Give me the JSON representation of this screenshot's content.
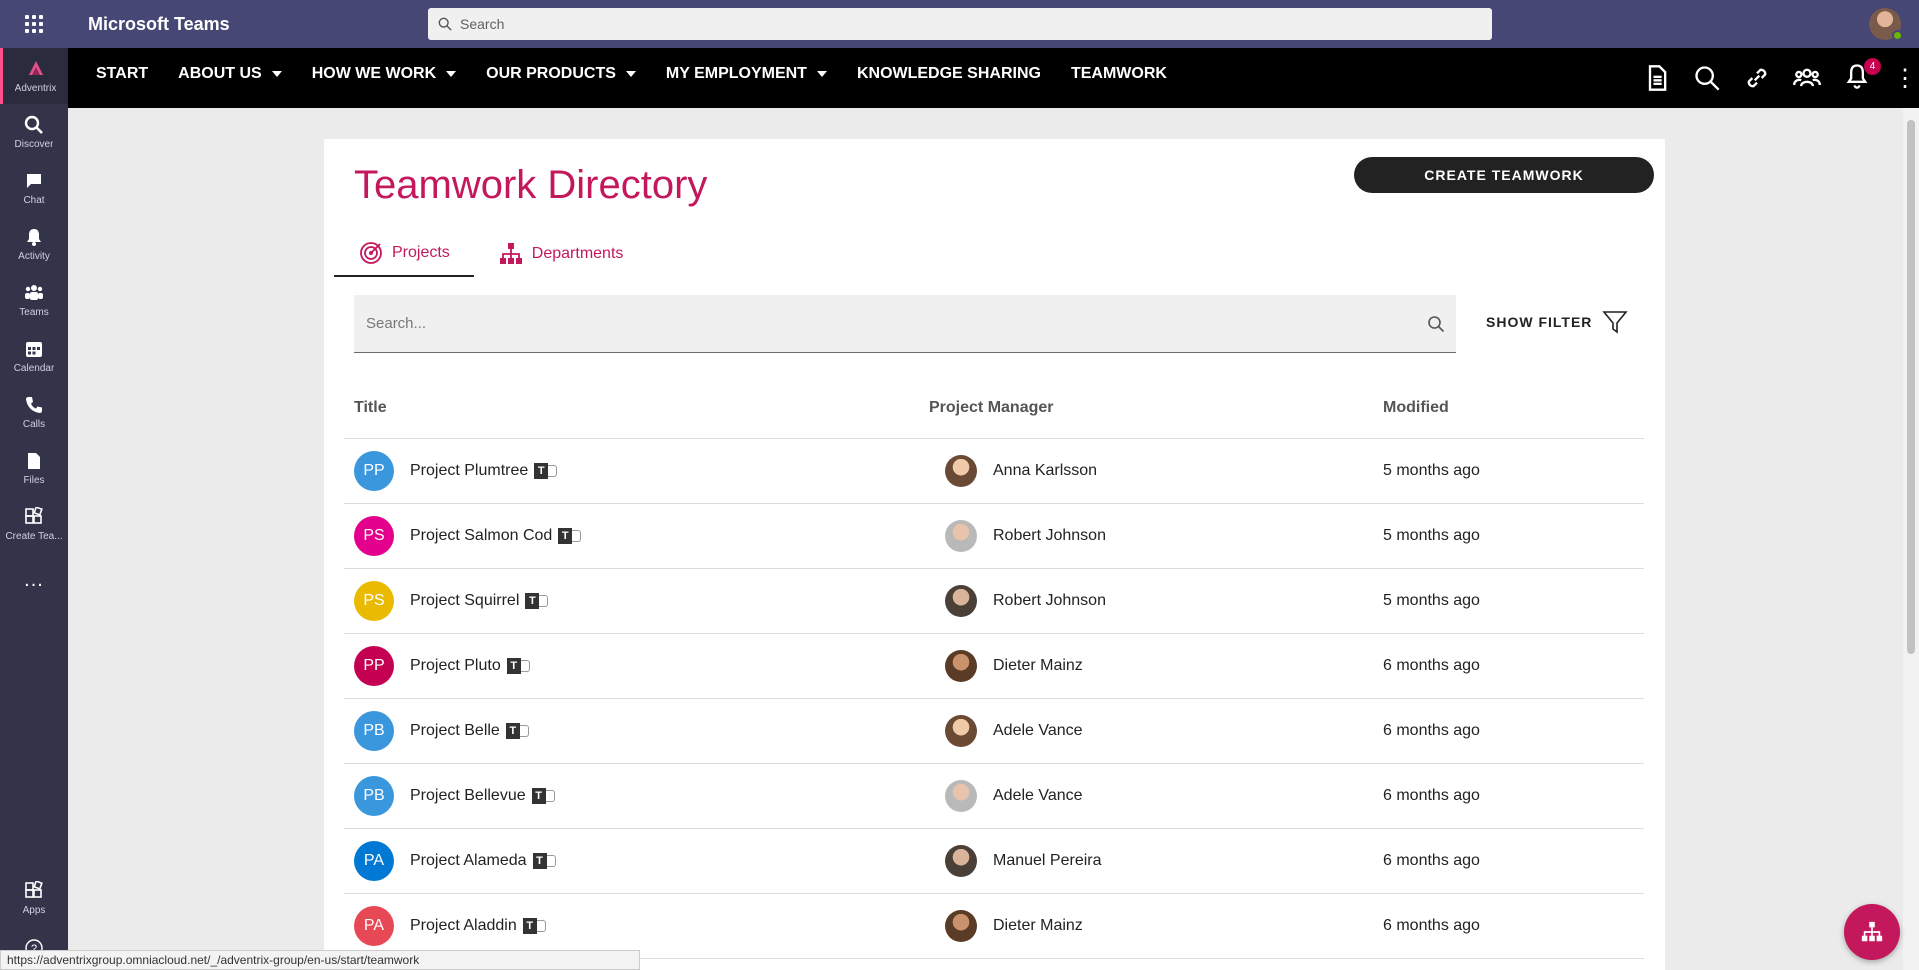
{
  "app": {
    "title": "Microsoft Teams",
    "search_placeholder": "Search"
  },
  "rail": {
    "items": [
      {
        "label": "Adventrix",
        "icon": "adventrix-logo-icon"
      },
      {
        "label": "Discover",
        "icon": "search-icon"
      },
      {
        "label": "Chat",
        "icon": "chat-icon"
      },
      {
        "label": "Activity",
        "icon": "bell-icon"
      },
      {
        "label": "Teams",
        "icon": "teams-icon"
      },
      {
        "label": "Calendar",
        "icon": "calendar-icon"
      },
      {
        "label": "Calls",
        "icon": "phone-icon"
      },
      {
        "label": "Files",
        "icon": "file-icon"
      },
      {
        "label": "Create Tea...",
        "icon": "create-team-icon"
      }
    ],
    "more": "...",
    "bottom": [
      {
        "label": "Apps",
        "icon": "apps-icon"
      },
      {
        "label": "",
        "icon": "help-icon"
      }
    ]
  },
  "nav": {
    "items": [
      {
        "label": "START",
        "dropdown": false
      },
      {
        "label": "ABOUT US",
        "dropdown": true
      },
      {
        "label": "HOW WE WORK",
        "dropdown": true
      },
      {
        "label": "OUR PRODUCTS",
        "dropdown": true
      },
      {
        "label": "MY EMPLOYMENT",
        "dropdown": true
      },
      {
        "label": "KNOWLEDGE SHARING",
        "dropdown": false
      },
      {
        "label": "TEAMWORK",
        "dropdown": false
      }
    ],
    "notification_count": "4"
  },
  "page": {
    "title": "Teamwork Directory",
    "create_button": "CREATE TEAMWORK",
    "tabs": [
      {
        "label": "Projects",
        "active": true
      },
      {
        "label": "Departments",
        "active": false
      }
    ],
    "search_placeholder": "Search...",
    "filter_label": "SHOW FILTER",
    "columns": {
      "title": "Title",
      "manager": "Project Manager",
      "modified": "Modified"
    },
    "rows": [
      {
        "initials": "PP",
        "color": "#3a96dd",
        "title": "Project Plumtree",
        "manager": "Anna Karlsson",
        "modified": "5 months ago"
      },
      {
        "initials": "PS",
        "color": "#e3008c",
        "title": "Project Salmon Cod",
        "manager": "Robert Johnson",
        "modified": "5 months ago"
      },
      {
        "initials": "PS",
        "color": "#eaba00",
        "title": "Project Squirrel",
        "manager": "Robert Johnson",
        "modified": "5 months ago"
      },
      {
        "initials": "PP",
        "color": "#c30052",
        "title": "Project Pluto",
        "manager": "Dieter Mainz",
        "modified": "6 months ago"
      },
      {
        "initials": "PB",
        "color": "#3a96dd",
        "title": "Project Belle",
        "manager": "Adele Vance",
        "modified": "6 months ago"
      },
      {
        "initials": "PB",
        "color": "#3a96dd",
        "title": "Project Bellevue",
        "manager": "Adele Vance",
        "modified": "6 months ago"
      },
      {
        "initials": "PA",
        "color": "#0078d4",
        "title": "Project Alameda",
        "manager": "Manuel Pereira",
        "modified": "6 months ago"
      },
      {
        "initials": "PA",
        "color": "#e74856",
        "title": "Project Aladdin",
        "manager": "Dieter Mainz",
        "modified": "6 months ago"
      }
    ]
  },
  "status_url": "https://adventrixgroup.omniacloud.net/_/adventrix-group/en-us/start/teamwork",
  "colors": {
    "accent": "#c4185c",
    "teams_bar": "#464775",
    "rail": "#33344a"
  }
}
